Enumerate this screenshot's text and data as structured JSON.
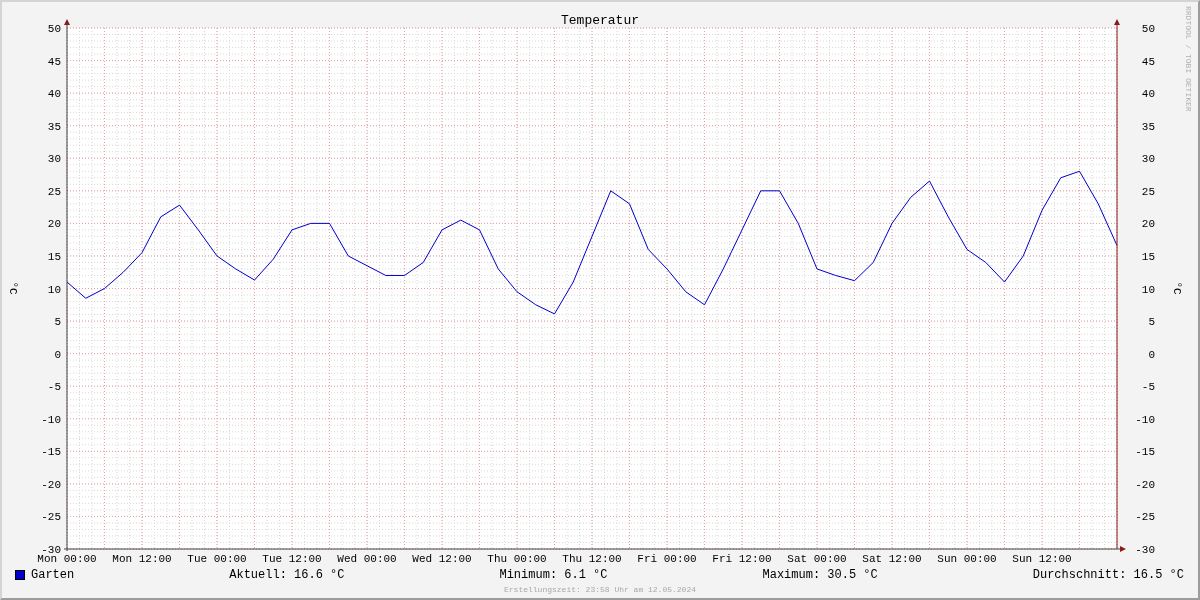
{
  "chart": {
    "watermark": "RRDTOOL / TOBI OETIKER",
    "right_ylabel": "°C",
    "right_yticks": [
      "50",
      "45",
      "40",
      "35",
      "30",
      "25",
      "20",
      "15",
      "10",
      "5",
      "0",
      "-5",
      "-10",
      "-15",
      "-20",
      "-25",
      "-30"
    ],
    "chart_data": {
      "type": "line",
      "title": "Temperatur",
      "ylabel": "°C",
      "categories": [
        "Mon 00:00",
        null,
        null,
        null,
        "Mon 12:00",
        null,
        null,
        null,
        "Tue 00:00",
        null,
        null,
        null,
        "Tue 12:00",
        null,
        null,
        null,
        "Wed 00:00",
        null,
        null,
        null,
        "Wed 12:00",
        null,
        null,
        null,
        "Thu 00:00",
        null,
        null,
        null,
        "Thu 12:00",
        null,
        null,
        null,
        "Fri 00:00",
        null,
        null,
        null,
        "Fri 12:00",
        null,
        null,
        null,
        "Sat 00:00",
        null,
        null,
        null,
        "Sat 12:00",
        null,
        null,
        null,
        "Sun 00:00",
        null,
        null,
        null,
        "Sun 12:00",
        null,
        null,
        null,
        null
      ],
      "series": [
        {
          "name": "Garten",
          "color": "#0000cc",
          "values": [
            11,
            8.5,
            10,
            12.5,
            15.5,
            21,
            22.8,
            19,
            15,
            13,
            11.3,
            14.5,
            19,
            20,
            20,
            15,
            13.5,
            12,
            12,
            14,
            19,
            20.5,
            19,
            13,
            9.5,
            7.5,
            6.1,
            11,
            18,
            25,
            23,
            16,
            13,
            9.5,
            7.5,
            13,
            19,
            25,
            25,
            20,
            13,
            12,
            11.2,
            14,
            20,
            24,
            26.5,
            21,
            16,
            14,
            11,
            15,
            22,
            27,
            28,
            23,
            16.6
          ]
        }
      ],
      "ylim": [
        -30,
        50
      ],
      "grid": true,
      "yticks": [
        {
          "value": 50,
          "label": "50"
        },
        {
          "value": 45,
          "label": "45"
        },
        {
          "value": 40,
          "label": "40"
        },
        {
          "value": 35,
          "label": "35"
        },
        {
          "value": 30,
          "label": "30"
        },
        {
          "value": 25,
          "label": "25"
        },
        {
          "value": 20,
          "label": "20"
        },
        {
          "value": 15,
          "label": "15"
        },
        {
          "value": 10,
          "label": "10"
        },
        {
          "value": 5,
          "label": "5"
        },
        {
          "value": 0,
          "label": "0"
        },
        {
          "value": -5,
          "label": "-5"
        },
        {
          "value": -10,
          "label": "-10"
        },
        {
          "value": -15,
          "label": "-15"
        },
        {
          "value": -20,
          "label": "-20"
        },
        {
          "value": -25,
          "label": "-25"
        },
        {
          "value": -30,
          "label": "-30"
        }
      ]
    }
  },
  "legend": {
    "color": "#0000cc",
    "stats": [
      "Aktuell: 16.6 °C",
      "Minimum: 6.1 °C",
      "Maximum: 30.5 °C",
      "Durchschnitt: 16.5 °C"
    ]
  },
  "footer": "Erstellungszeit: 23:58 Uhr am 12.05.2024"
}
